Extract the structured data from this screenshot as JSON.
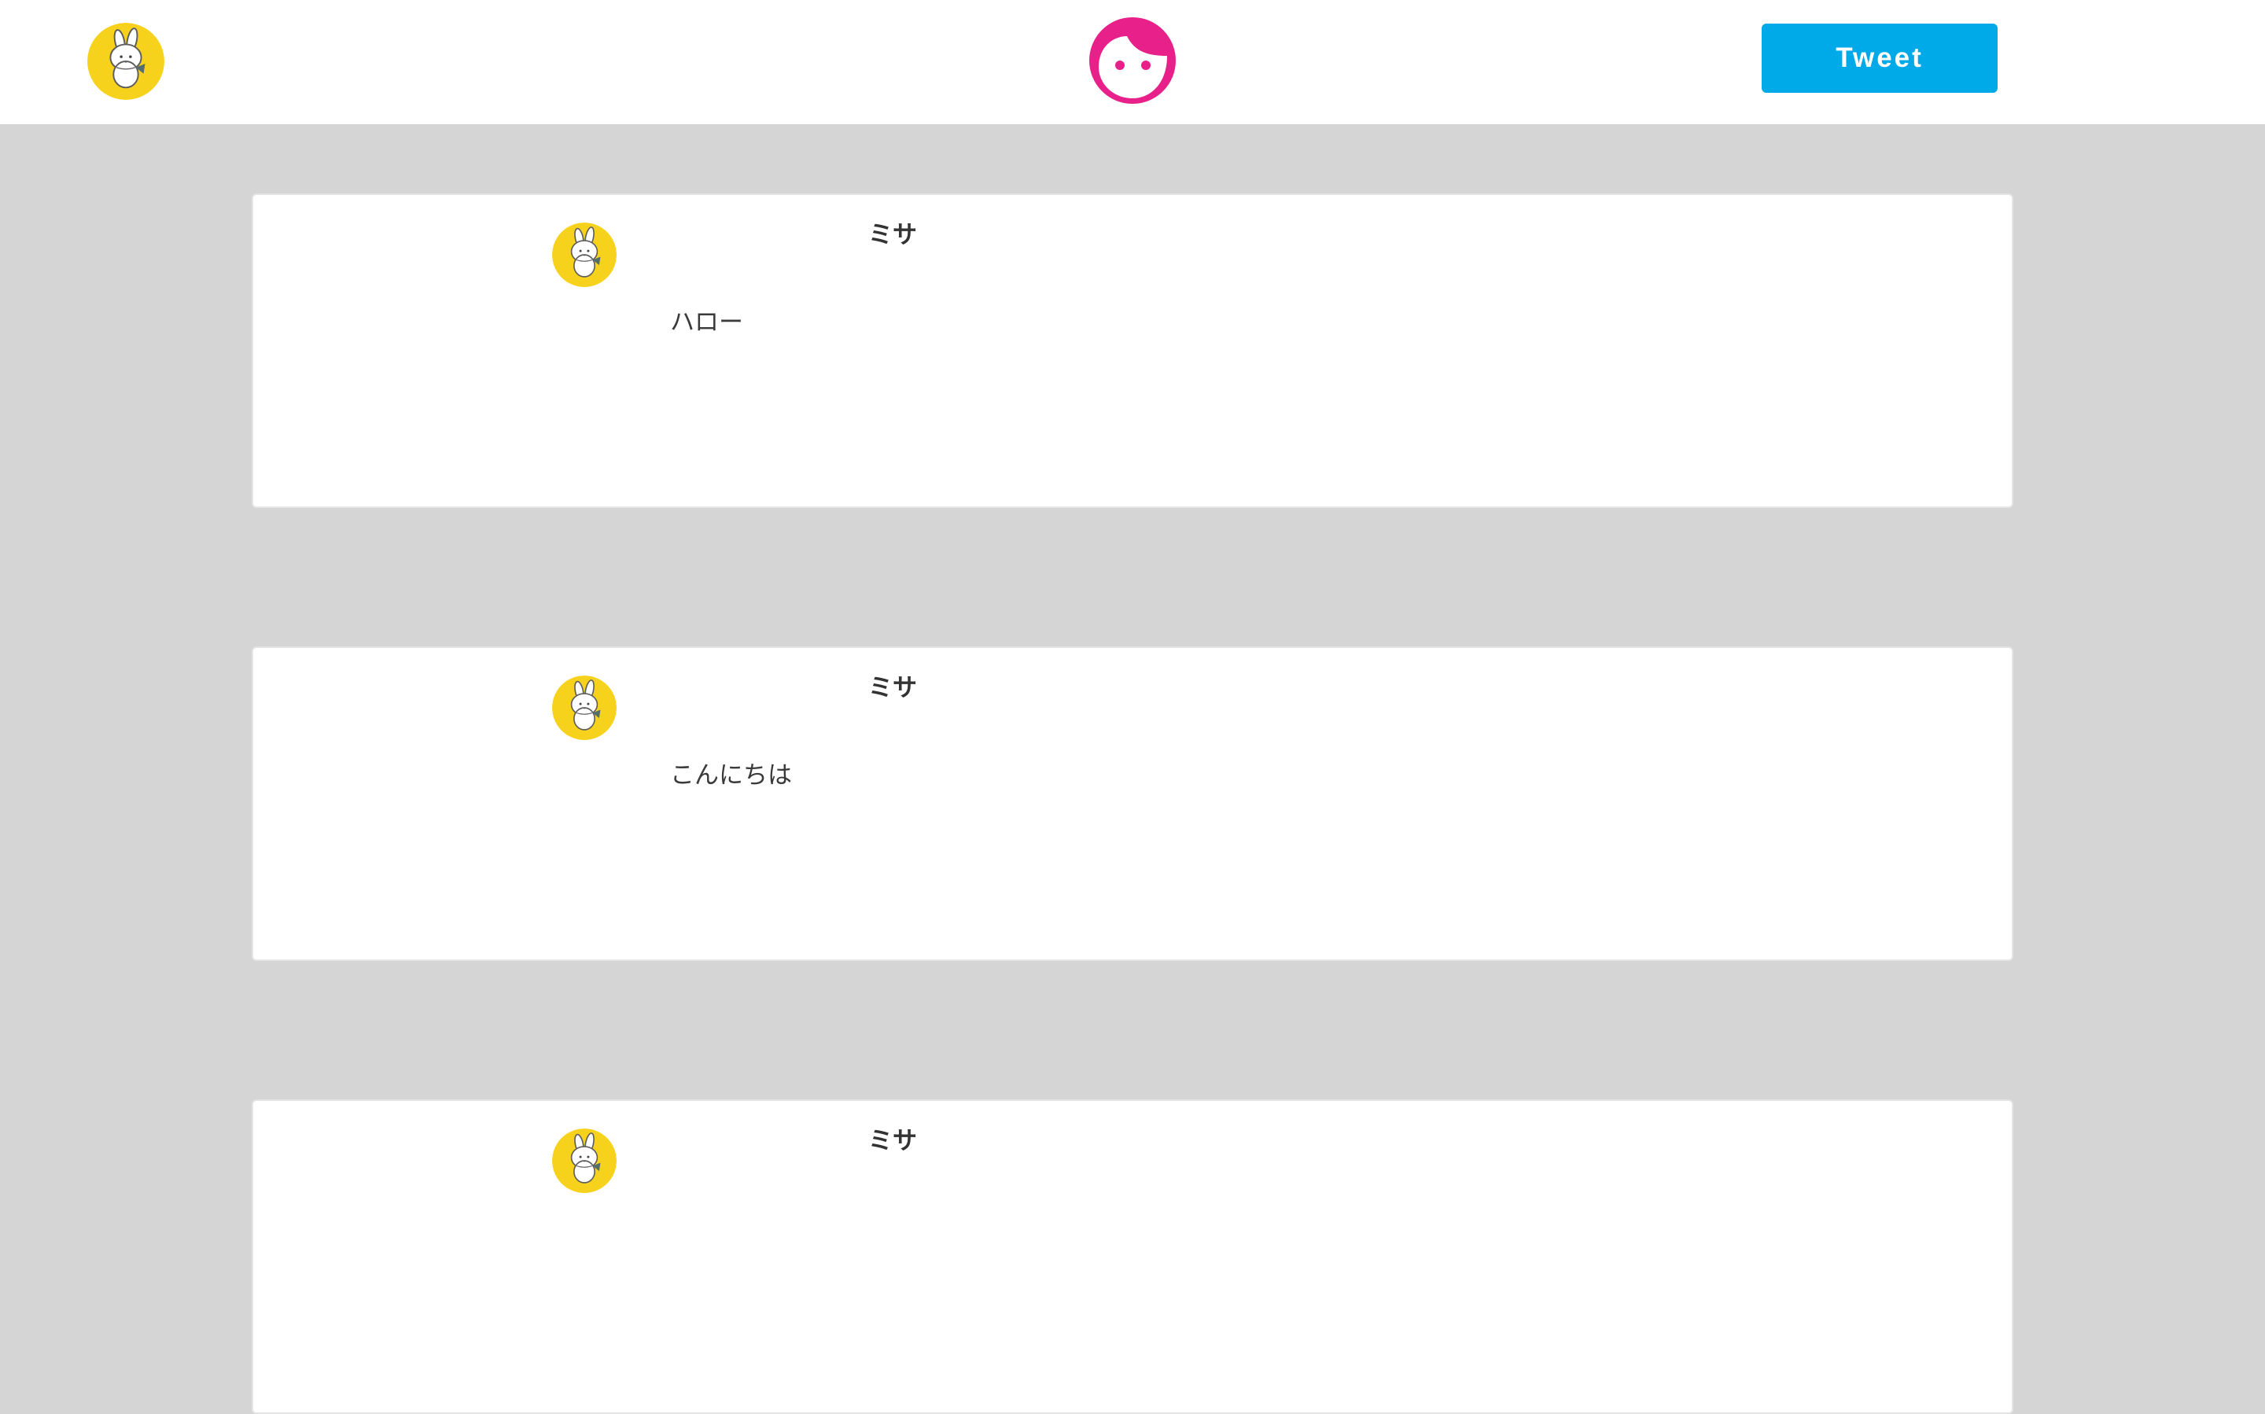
{
  "header": {
    "tweet_button_label": "Tweet",
    "avatar_icon": "rabbit-avatar-icon",
    "logo_icon": "girl-face-logo-icon"
  },
  "feed": {
    "posts": [
      {
        "author": "ミサ",
        "text": "ハロー",
        "avatar_icon": "rabbit-avatar-icon"
      },
      {
        "author": "ミサ",
        "text": "こんにちは",
        "avatar_icon": "rabbit-avatar-icon"
      },
      {
        "author": "ミサ",
        "text": "",
        "avatar_icon": "rabbit-avatar-icon"
      }
    ]
  },
  "colors": {
    "header_background": "#ffffff",
    "page_background": "#d5d5d5",
    "tweet_button": "#00a9e8",
    "logo_pink": "#e8208a",
    "avatar_yellow": "#f7d21c"
  }
}
